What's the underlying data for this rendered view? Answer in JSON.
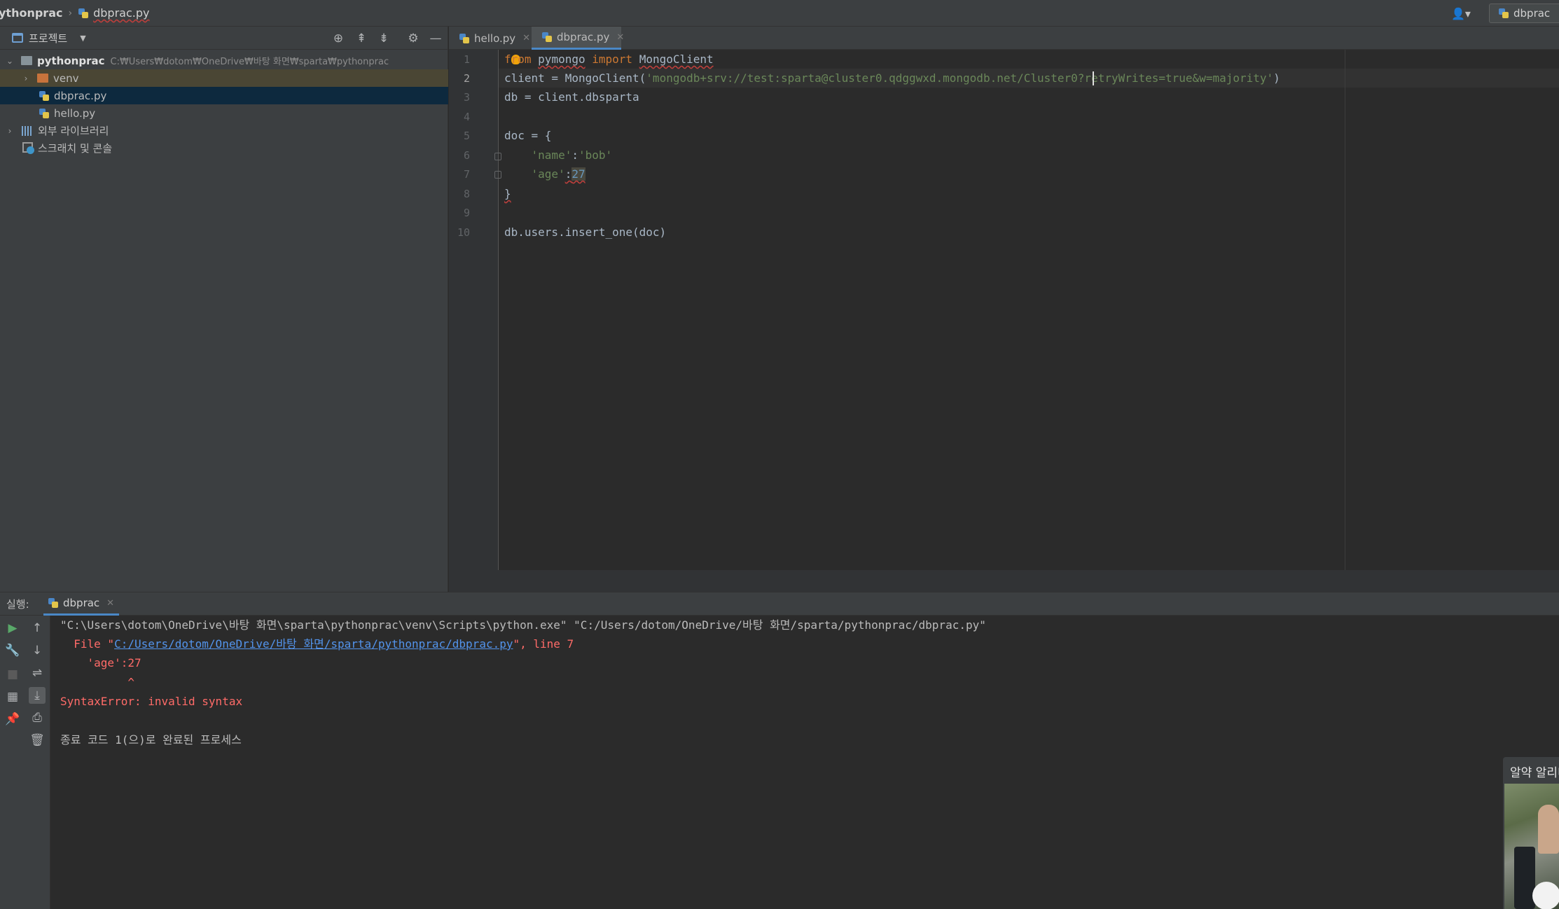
{
  "nav": {
    "project_name": "ythonprac",
    "file_name": "dbprac.py",
    "run_config": "dbprac"
  },
  "project_panel": {
    "title": "프로젝트",
    "tree": {
      "root": {
        "name": "pythonprac",
        "path": "C:₩Users₩dotom₩OneDrive₩바탕 화면₩sparta₩pythonprac"
      },
      "venv": "venv",
      "file1": "dbprac.py",
      "file2": "hello.py",
      "external_libs": "외부 라이브러리",
      "scratches": "스크래치 및 콘솔"
    }
  },
  "editor": {
    "tabs": [
      {
        "label": "hello.py",
        "active": false
      },
      {
        "label": "dbprac.py",
        "active": true
      }
    ],
    "line_numbers": [
      "1",
      "2",
      "3",
      "4",
      "5",
      "6",
      "7",
      "8",
      "9",
      "10"
    ],
    "code": {
      "l1_from": "from",
      "l1_module": "pymongo",
      "l1_import": "import",
      "l1_class": "MongoClient",
      "l2_prefix": "client = MongoClient(",
      "l2_str": "'mongodb+srv://test:sparta@cluster0.qdggwxd.mongodb.net/Cluster0?retryWrites=true&w=majority'",
      "l2_suffix": ")",
      "l3": "db = client.dbsparta",
      "l5": "doc = {",
      "l6_key": "'name'",
      "l6_colon": ":",
      "l6_val": "'bob'",
      "l7_key": "'age'",
      "l7_colon": ":",
      "l7_val": "27",
      "l8": "}",
      "l10": "db.users.insert_one(doc)"
    }
  },
  "run_panel": {
    "label": "실행:",
    "tab": "dbprac",
    "console": {
      "cmd": "\"C:\\Users\\dotom\\OneDrive\\바탕 화면\\sparta\\pythonprac\\venv\\Scripts\\python.exe\" \"C:/Users/dotom/OneDrive/바탕 화면/sparta/pythonprac/dbprac.py\"",
      "file_prefix": "  File \"",
      "file_link": "C:/Users/dotom/OneDrive/바탕 화면/sparta/pythonprac/dbprac.py",
      "file_suffix": "\", line 7",
      "src_line": "    'age':27",
      "caret_line": "          ^",
      "error": "SyntaxError: invalid syntax",
      "exit": "종료 코드 1(으)로 완료된 프로세스"
    }
  },
  "notification": {
    "title": "알약 알리미"
  },
  "colors": {
    "keyword": "#cc7832",
    "string": "#6a8759",
    "number": "#6897bb",
    "error": "#ff6b68",
    "link": "#5394ec",
    "accent": "#4a88c7"
  },
  "icons": [
    "python-file-icon",
    "folder-icon",
    "library-icon",
    "scratch-icon",
    "target-icon",
    "expand-all-icon",
    "collapse-all-icon",
    "gear-icon",
    "minimize-icon",
    "play-icon",
    "wrench-icon",
    "stop-icon",
    "layout-icon",
    "pin-icon",
    "up-arrow-icon",
    "down-arrow-icon",
    "soft-wrap-icon",
    "scroll-to-end-icon",
    "print-icon",
    "trash-icon",
    "user-icon",
    "bulb-icon"
  ]
}
